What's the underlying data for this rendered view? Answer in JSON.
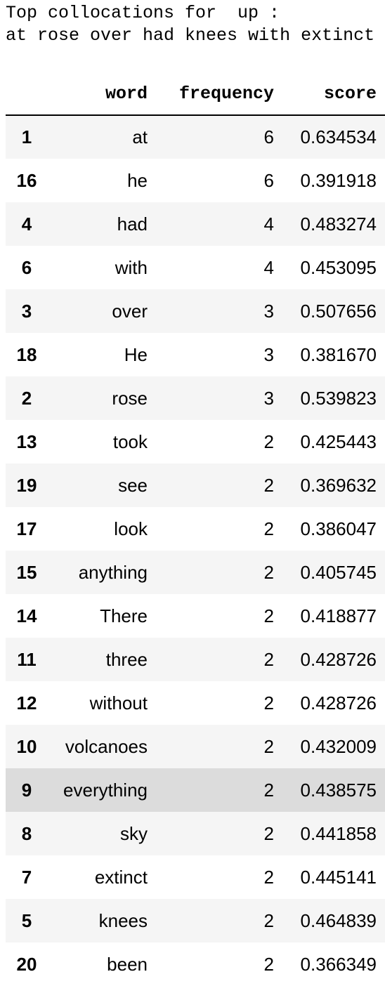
{
  "output": {
    "line1": "Top collocations for  up :",
    "line2": "at rose over had knees with extinct"
  },
  "table": {
    "columns": [
      "",
      "word",
      "frequency",
      "score"
    ],
    "rows": [
      {
        "index": "1",
        "word": "at",
        "frequency": "6",
        "score": "0.634534"
      },
      {
        "index": "16",
        "word": "he",
        "frequency": "6",
        "score": "0.391918"
      },
      {
        "index": "4",
        "word": "had",
        "frequency": "4",
        "score": "0.483274"
      },
      {
        "index": "6",
        "word": "with",
        "frequency": "4",
        "score": "0.453095"
      },
      {
        "index": "3",
        "word": "over",
        "frequency": "3",
        "score": "0.507656"
      },
      {
        "index": "18",
        "word": "He",
        "frequency": "3",
        "score": "0.381670"
      },
      {
        "index": "2",
        "word": "rose",
        "frequency": "3",
        "score": "0.539823"
      },
      {
        "index": "13",
        "word": "took",
        "frequency": "2",
        "score": "0.425443"
      },
      {
        "index": "19",
        "word": "see",
        "frequency": "2",
        "score": "0.369632"
      },
      {
        "index": "17",
        "word": "look",
        "frequency": "2",
        "score": "0.386047"
      },
      {
        "index": "15",
        "word": "anything",
        "frequency": "2",
        "score": "0.405745"
      },
      {
        "index": "14",
        "word": "There",
        "frequency": "2",
        "score": "0.418877"
      },
      {
        "index": "11",
        "word": "three",
        "frequency": "2",
        "score": "0.428726"
      },
      {
        "index": "12",
        "word": "without",
        "frequency": "2",
        "score": "0.428726"
      },
      {
        "index": "10",
        "word": "volcanoes",
        "frequency": "2",
        "score": "0.432009"
      },
      {
        "index": "9",
        "word": "everything",
        "frequency": "2",
        "score": "0.438575"
      },
      {
        "index": "8",
        "word": "sky",
        "frequency": "2",
        "score": "0.441858"
      },
      {
        "index": "7",
        "word": "extinct",
        "frequency": "2",
        "score": "0.445141"
      },
      {
        "index": "5",
        "word": "knees",
        "frequency": "2",
        "score": "0.464839"
      },
      {
        "index": "20",
        "word": "been",
        "frequency": "2",
        "score": "0.366349"
      }
    ]
  },
  "colors": {
    "stripe": "#f5f5f5",
    "hover": "#dcdcdc",
    "header_border": "#000000"
  }
}
